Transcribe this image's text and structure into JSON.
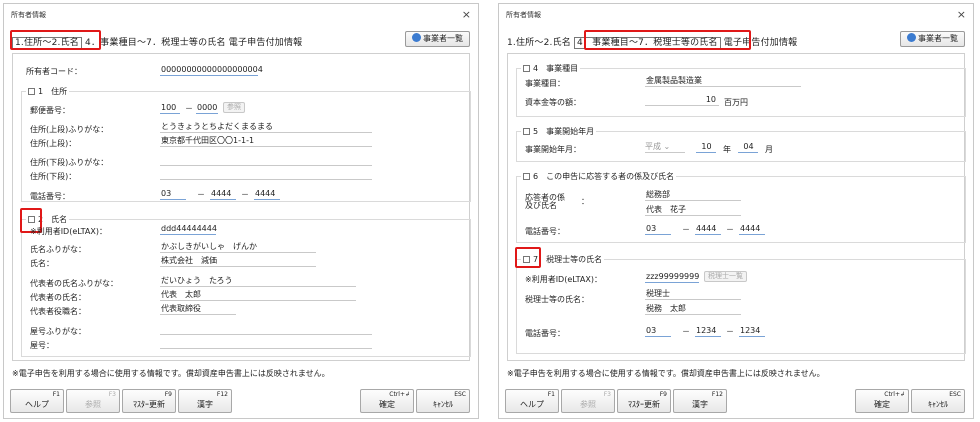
{
  "left": {
    "title": "所有者情報",
    "close": "×",
    "tabs": [
      "1.住所～2.氏名",
      "4．事業種目～7．税理士等の氏名",
      "電子申告付加情報"
    ],
    "btn_jigyo": "事業者一覧",
    "owner_code_label": "所有者コード：",
    "owner_code": "00000000000000000004",
    "sec1_title": "1　住所",
    "zip_label": "郵便番号：",
    "zip1": "100",
    "zip_dash": "－",
    "zip2": "0000",
    "ref_btn": "参照",
    "addr_kana_upper_label": "住所(上段)ふりがな：",
    "addr_kana_upper": "とうきょうとちよだくまるまる",
    "addr_upper_label": "住所(上段)：",
    "addr_upper": "東京都千代田区〇〇1-1-1",
    "addr_kana_lower_label": "住所(下段)ふりがな：",
    "addr_lower_label": "住所(下段)：",
    "tel_label": "電話番号：",
    "tel": [
      "03",
      "4444",
      "4444"
    ],
    "sec2_title": "2　氏名",
    "userid_label": "※利用者ID(eLTAX)：",
    "userid": "ddd44444444",
    "name_kana_label": "氏名ふりがな：",
    "name_kana": "かぶしきがいしゃ　げんか",
    "name_label": "氏名：",
    "name": "株式会社　減価",
    "rep_kana_label": "代表者の氏名ふりがな：",
    "rep_kana": "だいひょう　たろう",
    "rep_label": "代表者の氏名：",
    "rep": "代表　太郎",
    "rep_title_label": "代表者役職名：",
    "rep_title": "代表取締役",
    "yago_kana_label": "屋号ふりがな：",
    "yago_label": "屋号："
  },
  "right": {
    "title": "所有者情報",
    "close": "×",
    "tabs": [
      "1.住所～2.氏名",
      "4．事業種目～7．税理士等の氏名",
      "電子申告付加情報"
    ],
    "btn_jigyo": "事業者一覧",
    "sec4_title": "4　事業種目",
    "biz_label": "事業種目：",
    "biz": "金属製品製造業",
    "capital_label": "資本金等の額：",
    "capital": "10",
    "capital_unit": "百万円",
    "sec5_title": "5　事業開始年月",
    "start_label": "事業開始年月：",
    "era": "平成",
    "year": "10",
    "year_unit": "年",
    "month": "04",
    "month_unit": "月",
    "sec6_title": "6　この申告に応答する者の係及び氏名",
    "resp_label_1": "応答者の係",
    "resp_label_2": "及び氏名",
    "resp_colon": "：",
    "resp_dept": "総務部",
    "resp_name": "代表　花子",
    "tel_label": "電話番号：",
    "tel": [
      "03",
      "4444",
      "4444"
    ],
    "sec7_title": "7　税理士等の氏名",
    "userid_label": "※利用者ID(eLTAX)：",
    "userid": "zzz99999999",
    "tax_list_btn": "税理士一覧",
    "tax_name_label": "税理士等の氏名：",
    "tax_name_1": "税理士",
    "tax_name_2": "税務　太郎",
    "tel2_label": "電話番号：",
    "tel2": [
      "03",
      "1234",
      "1234"
    ]
  },
  "note": "※電子申告を利用する場合に使用する情報です。償却資産申告書上には反映されません。",
  "fkeys": [
    {
      "key": "F1",
      "name": "ヘルプ"
    },
    {
      "key": "F3",
      "name": "参照"
    },
    {
      "key": "F9",
      "name": "ﾏｽﾀｰ更新"
    },
    {
      "key": "F12",
      "name": "漢字"
    },
    {
      "key": "Ctrl+↲",
      "name": "確定"
    },
    {
      "key": "ESC",
      "name": "ｷｬﾝｾﾙ"
    }
  ],
  "dash": "－"
}
